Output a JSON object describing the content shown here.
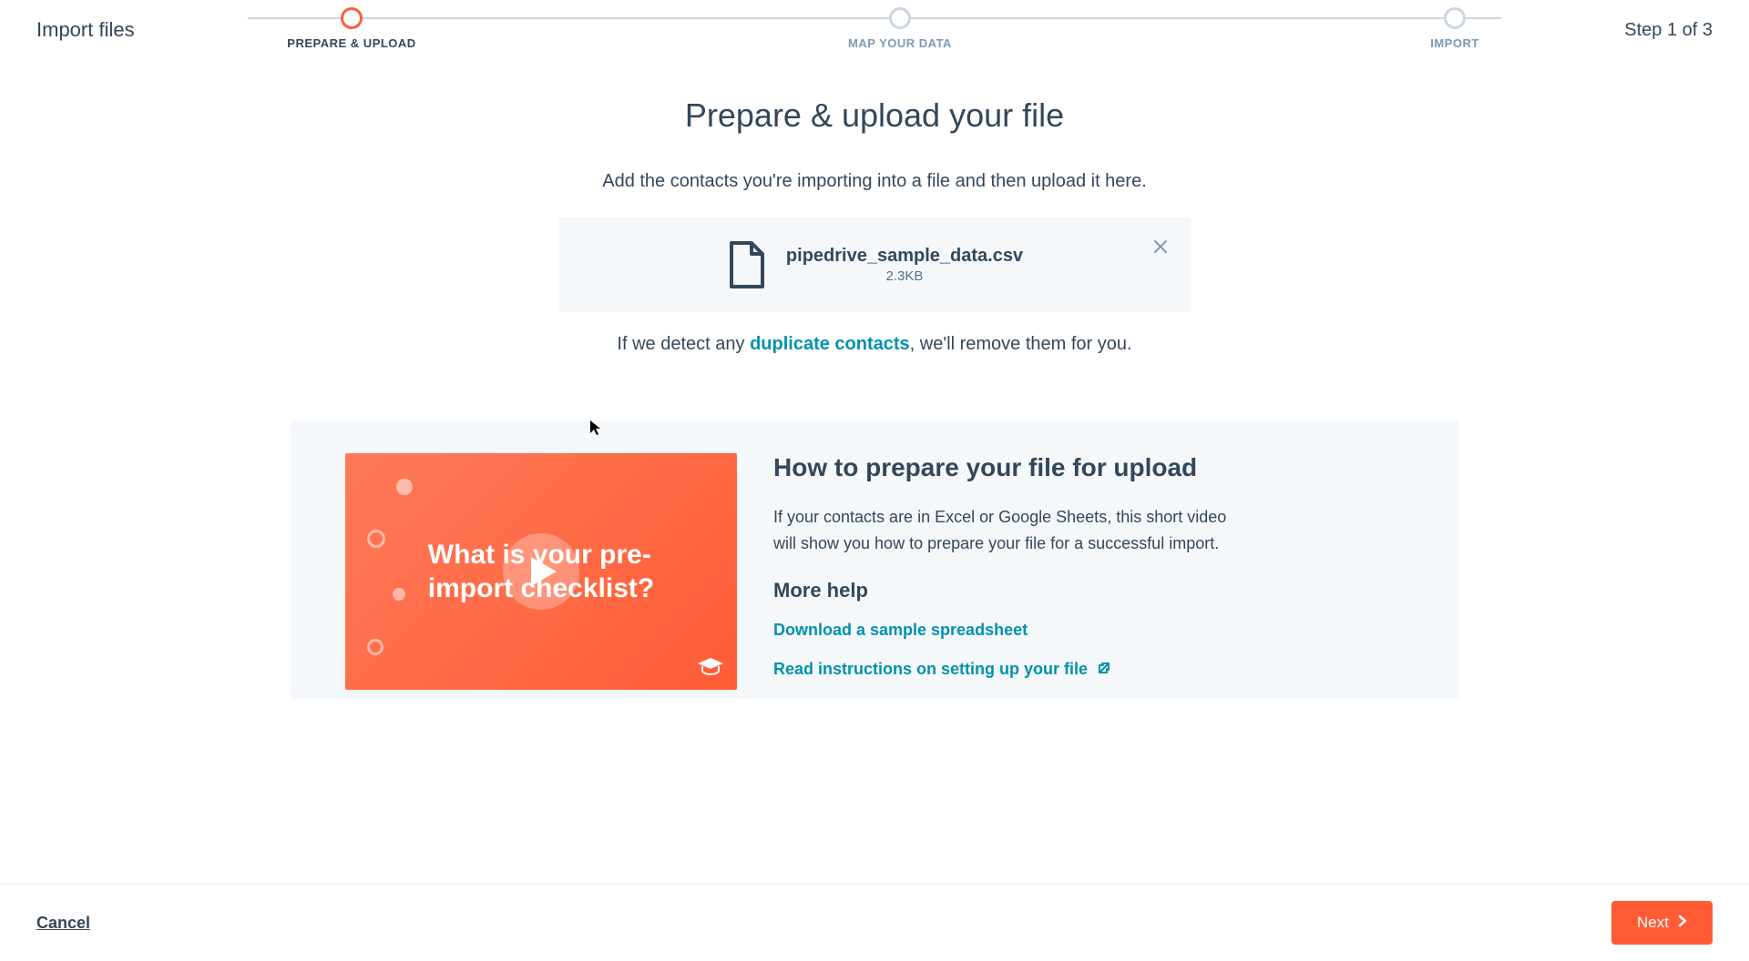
{
  "header": {
    "title": "Import files",
    "step_indicator": "Step 1 of 3"
  },
  "stepper": {
    "steps": [
      {
        "label": "PREPARE & UPLOAD",
        "active": true
      },
      {
        "label": "MAP YOUR DATA",
        "active": false
      },
      {
        "label": "IMPORT",
        "active": false
      }
    ]
  },
  "upload": {
    "heading": "Prepare & upload your file",
    "subtitle": "Add the contacts you're importing into a file and then upload it here.",
    "file": {
      "name": "pipedrive_sample_data.csv",
      "size": "2.3KB"
    },
    "duplicate_prefix": "If we detect any ",
    "duplicate_link": "duplicate contacts",
    "duplicate_suffix": ", we'll remove them for you."
  },
  "help": {
    "video_text_line1": "What is your pre-",
    "video_text_line2": "import checklist?",
    "title": "How to prepare your file for upload",
    "description": "If your contacts are in Excel or Google Sheets, this short video will show you how to prepare your file for a successful import.",
    "more_help_heading": "More help",
    "links": {
      "download_sample": "Download a sample spreadsheet",
      "read_instructions": "Read instructions on setting up your file"
    }
  },
  "footer": {
    "cancel": "Cancel",
    "next": "Next"
  }
}
